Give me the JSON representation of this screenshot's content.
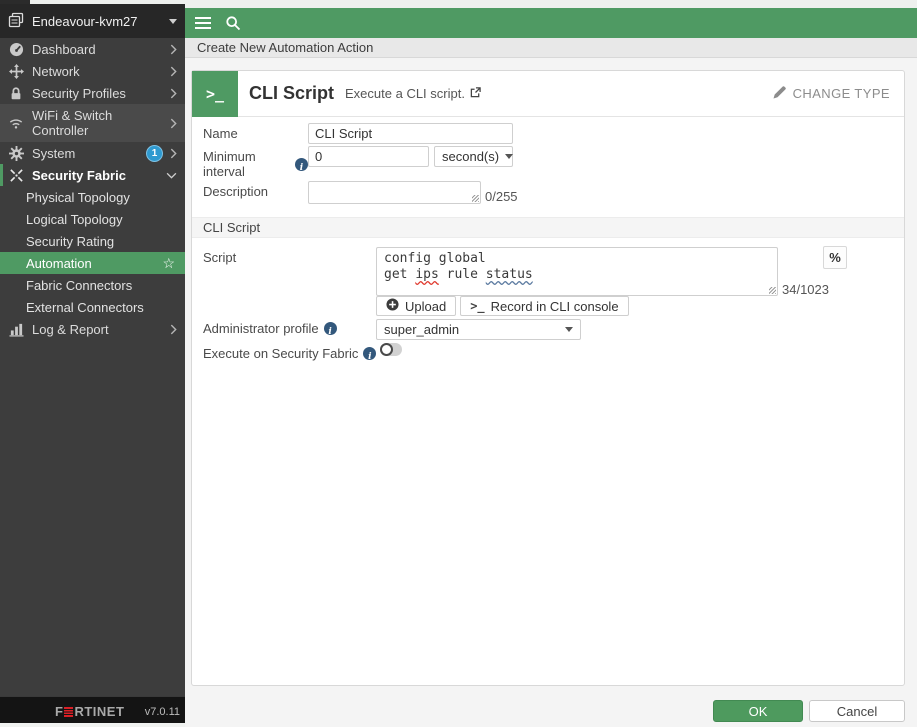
{
  "colors": {
    "accent_green": "#4f9a63",
    "sidebar_bg": "#3d3d3d",
    "badge_blue": "#2f9ad0",
    "info_icon_blue": "#33587c",
    "brand_red": "#da1f26",
    "ok_green": "#4e9a5e"
  },
  "sidebar": {
    "hostname": "Endeavour-kvm27",
    "items": [
      {
        "label": "Dashboard"
      },
      {
        "label": "Network"
      },
      {
        "label": "Security Profiles"
      },
      {
        "label": "WiFi & Switch Controller"
      },
      {
        "label": "System",
        "badge": "1"
      },
      {
        "label": "Security Fabric"
      },
      {
        "label": "Log & Report"
      }
    ],
    "fabric_items": [
      {
        "label": "Physical Topology"
      },
      {
        "label": "Logical Topology"
      },
      {
        "label": "Security Rating"
      },
      {
        "label": "Automation"
      },
      {
        "label": "Fabric Connectors"
      },
      {
        "label": "External Connectors"
      }
    ],
    "brand_prefix": "F",
    "brand_suffix": "RTINET",
    "version": "v7.0.11"
  },
  "header": {
    "breadcrumb": "Create New Automation Action"
  },
  "card": {
    "terminal_glyph": ">_",
    "title": "CLI Script",
    "subtitle": "Execute a CLI script.",
    "change_type_label": "CHANGE TYPE"
  },
  "form": {
    "name_label": "Name",
    "name_value": "CLI Script",
    "interval_label": "Minimum interval",
    "interval_value": "0",
    "interval_unit": "second(s)",
    "description_label": "Description",
    "description_counter": "0/255",
    "section_title": "CLI Script",
    "script_label": "Script",
    "script_line1": "config global",
    "script_line2_t1": "get ",
    "script_line2_t2": "ips",
    "script_line2_t3": " rule ",
    "script_line2_t4": "status",
    "script_counter": "34/1023",
    "variables_label": "%",
    "upload_label": "Upload",
    "record_glyph": ">_",
    "record_label": "Record in CLI console",
    "admin_label": "Administrator profile",
    "admin_value": "super_admin",
    "execute_label": "Execute on Security Fabric"
  },
  "actions": {
    "ok": "OK",
    "cancel": "Cancel"
  }
}
